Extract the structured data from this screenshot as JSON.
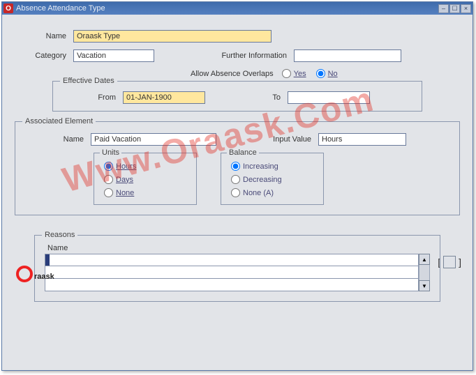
{
  "window": {
    "title": "Absence Attendance Type"
  },
  "labels": {
    "name": "Name",
    "category": "Category",
    "further_info": "Further Information",
    "allow_overlap": "Allow Absence Overlaps",
    "eff_dates": "Effective Dates",
    "from": "From",
    "to": "To",
    "assoc_elem": "Associated Element",
    "input_value": "Input Value",
    "units": "Units",
    "balance": "Balance",
    "reasons": "Reasons",
    "reason_name": "Name"
  },
  "values": {
    "name": "Oraask Type",
    "category": "Vacation",
    "further_info": "",
    "eff_from": "01-JAN-1900",
    "eff_to": "",
    "assoc_name": "Paid Vacation",
    "input_value": "Hours"
  },
  "radios": {
    "overlap_yes": "Yes",
    "overlap_no": "No",
    "hours": "Hours",
    "days": "Days",
    "none": "None",
    "increasing": "Increasing",
    "decreasing": "Decreasing",
    "none_a": "None (A)"
  },
  "watermark": "Www.Oraask.Com"
}
